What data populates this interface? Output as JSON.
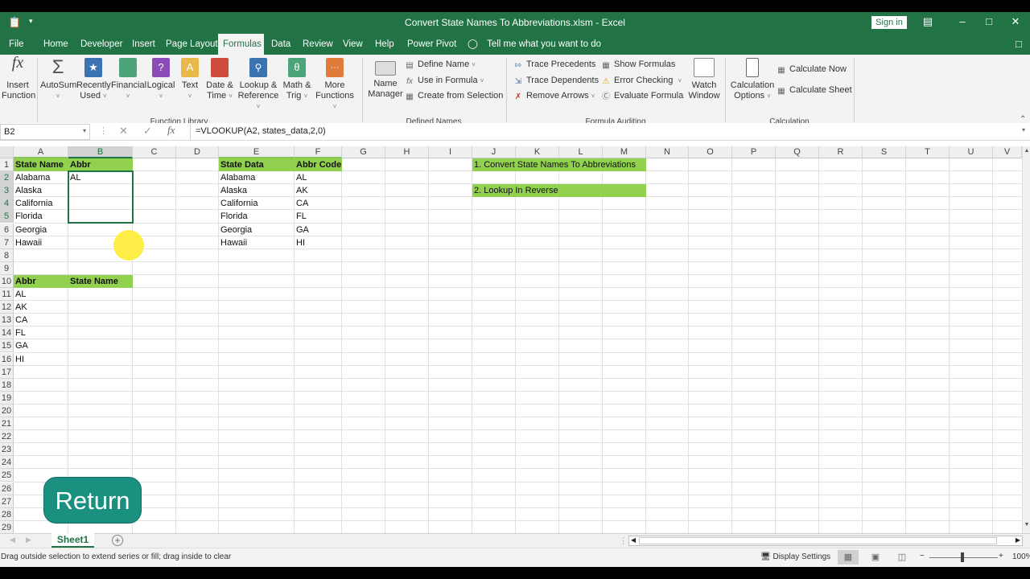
{
  "titlebar": {
    "title": "Convert State Names To Abbreviations.xlsm  -  Excel",
    "sign_in": "Sign in",
    "ribbon_display_icon": "ribbon-display-icon",
    "minimize": "–",
    "restore": "□",
    "close": "✕"
  },
  "tabs": [
    {
      "label": "File"
    },
    {
      "label": "Home"
    },
    {
      "label": "Developer"
    },
    {
      "label": "Insert"
    },
    {
      "label": "Page Layout"
    },
    {
      "label": "Formulas",
      "active": true
    },
    {
      "label": "Data"
    },
    {
      "label": "Review"
    },
    {
      "label": "View"
    },
    {
      "label": "Help"
    },
    {
      "label": "Power Pivot"
    }
  ],
  "tell_me": "Tell me what you want to do",
  "ribbon": {
    "function_library": {
      "label": "Function Library",
      "insert_function": [
        "Insert",
        "Function"
      ],
      "autosum": "AutoSum",
      "recently_used": [
        "Recently",
        "Used"
      ],
      "financial": "Financial",
      "logical": "Logical",
      "text": "Text",
      "date_time": [
        "Date &",
        "Time"
      ],
      "lookup_reference": [
        "Lookup &",
        "Reference"
      ],
      "math_trig": [
        "Math &",
        "Trig"
      ],
      "more_functions": [
        "More",
        "Functions"
      ]
    },
    "defined_names": {
      "label": "Defined Names",
      "name_manager": [
        "Name",
        "Manager"
      ],
      "define_name": "Define Name",
      "use_in_formula": "Use in Formula",
      "create_from_selection": "Create from Selection"
    },
    "formula_auditing": {
      "label": "Formula Auditing",
      "trace_precedents": "Trace Precedents",
      "trace_dependents": "Trace Dependents",
      "remove_arrows": "Remove Arrows",
      "show_formulas": "Show Formulas",
      "error_checking": "Error Checking",
      "evaluate_formula": "Evaluate Formula",
      "watch_window": [
        "Watch",
        "Window"
      ]
    },
    "calculation": {
      "label": "Calculation",
      "calculation_options": [
        "Calculation",
        "Options"
      ],
      "calculate_now": "Calculate Now",
      "calculate_sheet": "Calculate Sheet"
    }
  },
  "formula_bar": {
    "name_box": "B2",
    "formula": "=VLOOKUP(A2, states_data,2,0)"
  },
  "columns": [
    "A",
    "B",
    "C",
    "D",
    "E",
    "F",
    "G",
    "H",
    "I",
    "J",
    "K",
    "L",
    "M",
    "N",
    "O",
    "P",
    "Q",
    "R",
    "S",
    "T",
    "U",
    "V"
  ],
  "rows": [
    "1",
    "2",
    "3",
    "4",
    "5",
    "6",
    "7",
    "8",
    "9",
    "10",
    "11",
    "12",
    "13",
    "14",
    "15",
    "16",
    "17",
    "18",
    "19",
    "20",
    "21",
    "22",
    "23",
    "24",
    "25",
    "26",
    "27",
    "28",
    "29"
  ],
  "cells": {
    "A1": "State Name",
    "B1": "Abbr",
    "A2": "Alabama",
    "B2": "AL",
    "A3": "Alaska",
    "A4": "California",
    "A5": "Florida",
    "A6": "Georgia",
    "A7": "Hawaii",
    "E1": "State Data",
    "F1": "Abbr Code",
    "E2": "Alabama",
    "F2": "AL",
    "E3": "Alaska",
    "F3": "AK",
    "E4": "California",
    "F4": "CA",
    "E5": "Florida",
    "F5": "FL",
    "E6": "Georgia",
    "F6": "GA",
    "E7": "Hawaii",
    "F7": "HI",
    "A10": "Abbr",
    "B10": "State Name",
    "A11": "AL",
    "A12": "AK",
    "A13": "CA",
    "A14": "FL",
    "A15": "GA",
    "A16": "HI",
    "J1": "1. Convert State Names To Abbreviations",
    "J3": "2. Lookup In Reverse"
  },
  "overlay_button": "Return",
  "sheet_tabs": [
    {
      "label": "Sheet1",
      "active": true
    }
  ],
  "status": {
    "message": "Drag outside selection to extend series or fill; drag inside to clear",
    "display_settings": "Display Settings",
    "zoom": "100%",
    "zoom_minus": "−",
    "zoom_plus": "+"
  },
  "colors": {
    "brand": "#217346",
    "header_fill": "#92d050",
    "return_button": "#1a9080"
  }
}
